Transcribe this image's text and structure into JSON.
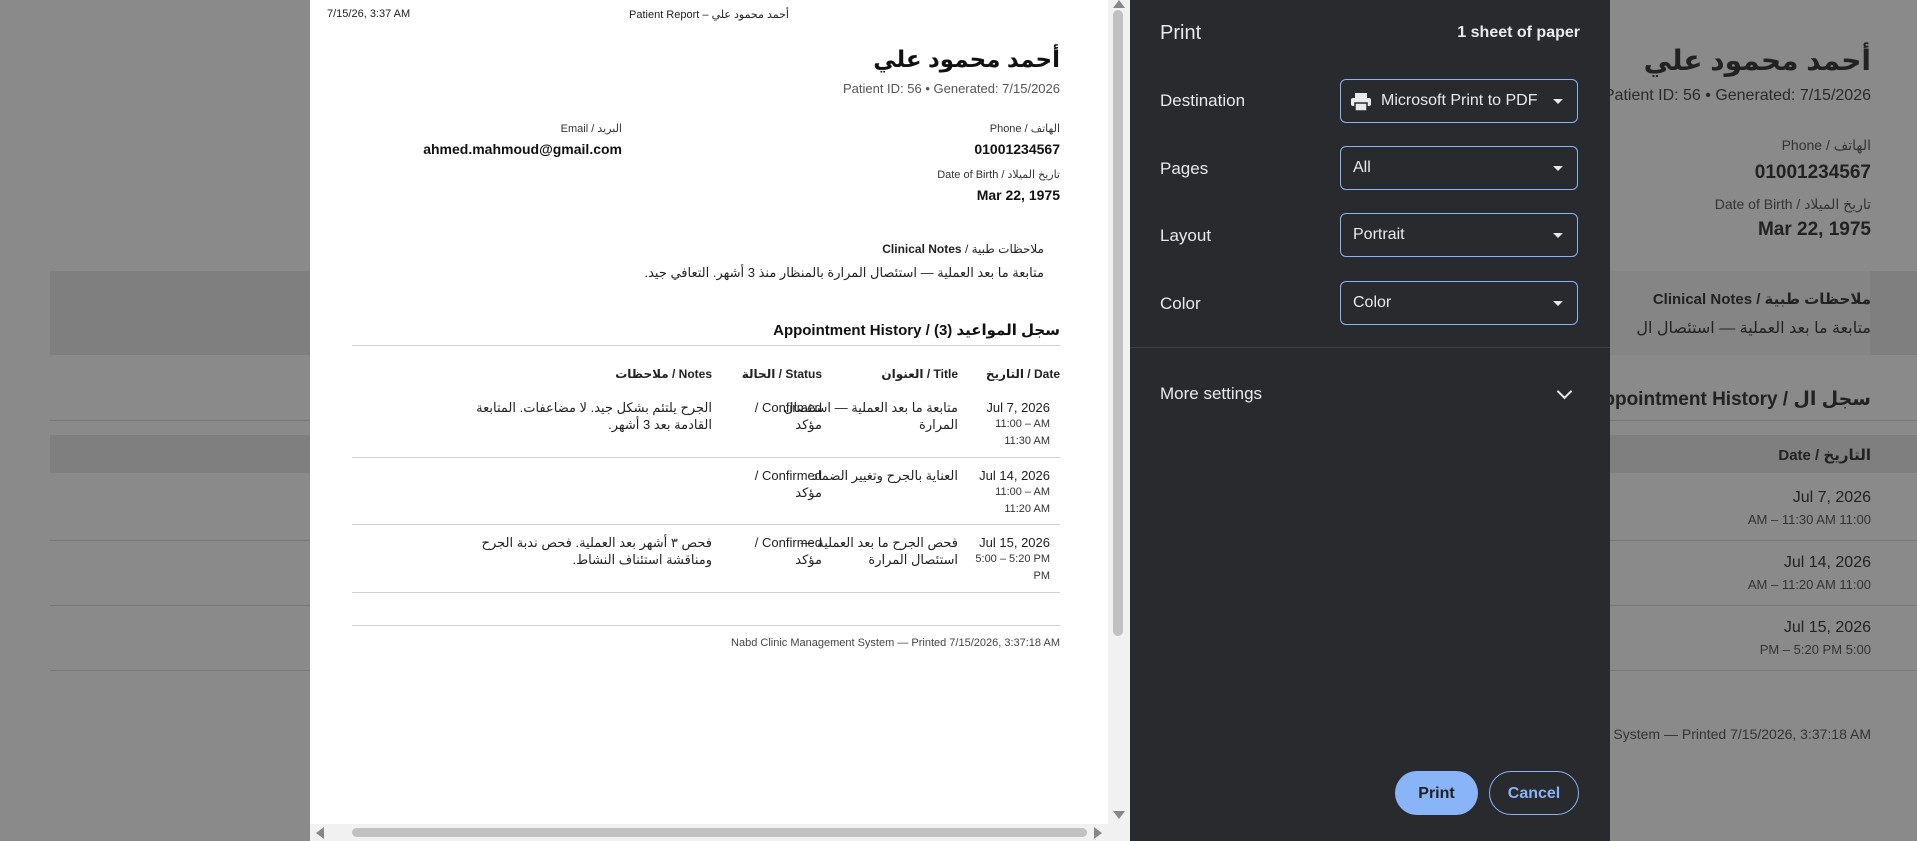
{
  "background": {
    "patient_name": "أحمد محمود علي",
    "meta": "Patient ID: 56  •  Generated: 7/15/2026",
    "phone_label": "Phone / الهاتف",
    "phone": "01001234567",
    "dob_label": "Date of Birth / تاريخ الميلاد",
    "dob": "Mar 22, 1975",
    "notes_title": "Clinical Notes / ملاحظات طبية",
    "notes_partial": "متابعة ما بعد العملية — استئصال ال",
    "appt_title_partial": "Appointment History / سجل ال",
    "date_header": "Date / التاريخ",
    "rows": [
      {
        "date": "Jul 7, 2026",
        "time": "11:00 AM – 11:30 AM"
      },
      {
        "date": "Jul 14, 2026",
        "time": "11:00 AM – 11:20 AM"
      },
      {
        "date": "Jul 15, 2026",
        "time": "5:00 PM – 5:20 PM"
      }
    ],
    "footer_partial": "t System — Printed 7/15/2026, 3:37:18 AM"
  },
  "preview": {
    "header_date": "7/15/26, 3:37 AM",
    "header_title": "Patient Report – أحمد محمود علي",
    "patient_name": "أحمد محمود علي",
    "patient_meta": "Patient ID: 56  •  Generated: 7/15/2026",
    "email_label": "Email / البريد",
    "email": "ahmed.mahmoud@gmail.com",
    "phone_label": "Phone / الهاتف",
    "phone": "01001234567",
    "dob_label": "Date of Birth / تاريخ الميلاد",
    "dob": "Mar 22, 1975",
    "notes_title": "Clinical Notes / ملاحظات طبية",
    "notes_body": "متابعة ما بعد العملية — استئصال المرارة بالمنظار منذ 3 أشهر. التعافي جيد.",
    "appointments_title": "Appointment History / سجل المواعيد (3)",
    "columns": {
      "date": "Date / التاريخ",
      "title": "Title / العنوان",
      "status": "Status / الحالة",
      "notes": "Notes / ملاحظات"
    },
    "appointments": [
      {
        "date": "Jul 7, 2026",
        "time1": "11:00 – AM",
        "time2": "11:30 AM",
        "title": "متابعة ما بعد العملية — استئصال المرارة",
        "status": "Confirmed / مؤكد",
        "notes": "الجرح يلتئم بشكل جيد. لا مضاعفات. المتابعة القادمة بعد 3 أشهر."
      },
      {
        "date": "Jul 14, 2026",
        "time1": "11:00 – AM",
        "time2": "11:20 AM",
        "title": "العناية بالجرح وتغيير الضماد",
        "status": "Confirmed / مؤكد",
        "notes": ""
      },
      {
        "date": "Jul 15, 2026",
        "time1": "5:00 – 5:20 PM",
        "time2": "PM",
        "title": "فحص الجرح ما بعد العملية — استئصال المرارة",
        "status": "Confirmed / مؤكد",
        "notes": "فحص ٣ أشهر بعد العملية. فحص ندبة الجرح ومناقشة استئناف النشاط."
      }
    ],
    "footer": "Nabd Clinic Management System — Printed 7/15/2026, 3:37:18 AM"
  },
  "print_panel": {
    "title": "Print",
    "sheets": "1 sheet of paper",
    "destination_label": "Destination",
    "destination_value": "Microsoft Print to PDF",
    "destination_icon": "printer-icon",
    "pages_label": "Pages",
    "pages_value": "All",
    "layout_label": "Layout",
    "layout_value": "Portrait",
    "color_label": "Color",
    "color_value": "Color",
    "more_settings": "More settings",
    "print_button": "Print",
    "cancel_button": "Cancel",
    "accent_color": "#8ab4f8",
    "panel_bg": "#292a2d"
  }
}
